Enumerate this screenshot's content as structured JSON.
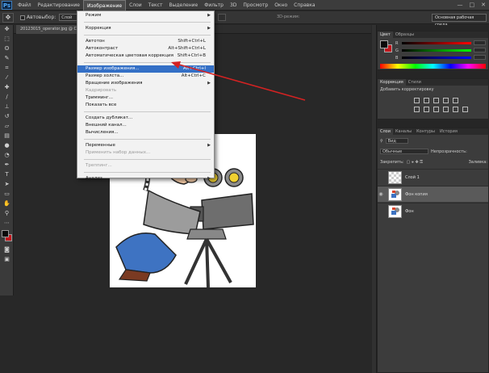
{
  "menubar": {
    "logo": "Ps",
    "items": [
      "Файл",
      "Редактирование",
      "Изображение",
      "Слои",
      "Текст",
      "Выделение",
      "Фильтр",
      "3D",
      "Просмотр",
      "Окно",
      "Справка"
    ],
    "window_controls": [
      "—",
      "□",
      "✕"
    ]
  },
  "options": {
    "autoselect_label": "Автовыбор:",
    "autoselect_value": "Слой",
    "mode_3d": "3D-режим:",
    "workspace": "Основная рабочая среда"
  },
  "document": {
    "tab_title": "20123015_operator.jpg @ Слой 1"
  },
  "image_menu": {
    "items": [
      {
        "label": "Режим",
        "shortcut": "",
        "submenu": true,
        "state": "normal"
      },
      {
        "sep": true
      },
      {
        "label": "Коррекция",
        "shortcut": "",
        "submenu": true,
        "state": "normal"
      },
      {
        "sep": true
      },
      {
        "label": "Автотон",
        "shortcut": "Shift+Ctrl+L",
        "submenu": false,
        "state": "normal"
      },
      {
        "label": "Автоконтраст",
        "shortcut": "Alt+Shift+Ctrl+L",
        "submenu": false,
        "state": "normal"
      },
      {
        "label": "Автоматическая цветовая коррекция",
        "shortcut": "Shift+Ctrl+B",
        "submenu": false,
        "state": "normal"
      },
      {
        "sep": true
      },
      {
        "label": "Размер изображения...",
        "shortcut": "Alt+Ctrl+I",
        "submenu": false,
        "state": "highlighted"
      },
      {
        "label": "Размер холста...",
        "shortcut": "Alt+Ctrl+C",
        "submenu": false,
        "state": "normal"
      },
      {
        "label": "Вращение изображения",
        "shortcut": "",
        "submenu": true,
        "state": "normal"
      },
      {
        "label": "Кадрировать",
        "shortcut": "",
        "submenu": false,
        "state": "disabled"
      },
      {
        "label": "Тримминг...",
        "shortcut": "",
        "submenu": false,
        "state": "normal"
      },
      {
        "label": "Показать все",
        "shortcut": "",
        "submenu": false,
        "state": "normal"
      },
      {
        "sep": true
      },
      {
        "label": "Создать дубликат...",
        "shortcut": "",
        "submenu": false,
        "state": "normal"
      },
      {
        "label": "Внешний канал...",
        "shortcut": "",
        "submenu": false,
        "state": "normal"
      },
      {
        "label": "Вычисления...",
        "shortcut": "",
        "submenu": false,
        "state": "normal"
      },
      {
        "sep": true
      },
      {
        "label": "Переменные",
        "shortcut": "",
        "submenu": true,
        "state": "normal"
      },
      {
        "label": "Применить набор данных...",
        "shortcut": "",
        "submenu": false,
        "state": "disabled"
      },
      {
        "sep": true
      },
      {
        "label": "Треппинг...",
        "shortcut": "",
        "submenu": false,
        "state": "disabled"
      },
      {
        "sep": true
      },
      {
        "label": "Анализ",
        "shortcut": "",
        "submenu": true,
        "state": "normal"
      }
    ]
  },
  "color_panel": {
    "tabs": [
      "Цвет",
      "Образцы"
    ],
    "channels": [
      "R",
      "G",
      "B"
    ],
    "colors": {
      "fg": "#0a0a0a",
      "bg": "#c2161d"
    }
  },
  "adjustments_panel": {
    "tabs": [
      "Коррекция",
      "Стили"
    ],
    "title": "Добавить корректировку"
  },
  "layers_panel": {
    "tabs": [
      "Слои",
      "Каналы",
      "Контуры",
      "История"
    ],
    "kind_filter": "Вид",
    "blend_mode": "Обычные",
    "opacity_label": "Непрозрачность:",
    "lock_label": "Закрепить:",
    "fill_label": "Заливка:",
    "layers": [
      {
        "name": "Слой 1",
        "visible": false,
        "selected": false
      },
      {
        "name": "Фон копия",
        "visible": true,
        "selected": true
      },
      {
        "name": "Фон",
        "visible": false,
        "selected": false
      }
    ]
  },
  "accent": {
    "highlight": "#3470c6",
    "arrow": "#d42222"
  }
}
